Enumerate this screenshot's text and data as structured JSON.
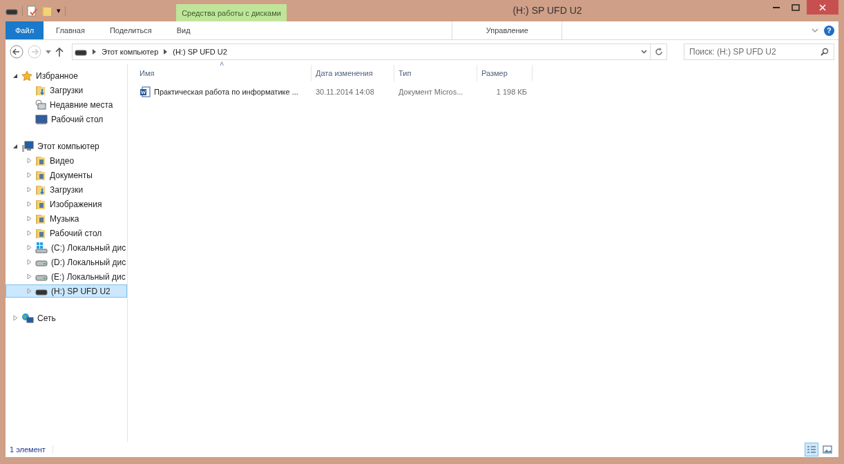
{
  "window": {
    "title": "(H:) SP UFD U2"
  },
  "quick_access": {
    "menu_glyph": "▾"
  },
  "contextual_group": {
    "label": "Средства работы с дисками"
  },
  "ribbon_tabs": [
    {
      "label": "Файл",
      "kind": "file",
      "selected": false
    },
    {
      "label": "Главная",
      "kind": "tab",
      "selected": false
    },
    {
      "label": "Поделиться",
      "kind": "tab",
      "selected": false
    },
    {
      "label": "Вид",
      "kind": "tab",
      "selected": false
    },
    {
      "label": "Управление",
      "kind": "contextual",
      "selected": false
    }
  ],
  "help": {
    "label": "?"
  },
  "address_bar": {
    "crumbs": [
      "Этот компьютер",
      "(H:) SP UFD U2"
    ]
  },
  "search": {
    "placeholder": "Поиск: (H:) SP UFD U2"
  },
  "navigation": [
    {
      "label": "Избранное",
      "kind": "favorites",
      "expanded": true,
      "selected": false,
      "children": [
        {
          "label": "Загрузки",
          "kind": "downloads",
          "selected": false
        },
        {
          "label": "Недавние места",
          "kind": "recent",
          "selected": false
        },
        {
          "label": "Рабочий стол",
          "kind": "desktop",
          "selected": false
        }
      ]
    },
    {
      "label": "Этот компьютер",
      "kind": "computer",
      "expanded": true,
      "selected": false,
      "children": [
        {
          "label": "Видео",
          "kind": "folder",
          "expanded": false,
          "selected": false
        },
        {
          "label": "Документы",
          "kind": "folder",
          "expanded": false,
          "selected": false
        },
        {
          "label": "Загрузки",
          "kind": "downloads",
          "expanded": false,
          "selected": false
        },
        {
          "label": "Изображения",
          "kind": "folder",
          "expanded": false,
          "selected": false
        },
        {
          "label": "Музыка",
          "kind": "folder",
          "expanded": false,
          "selected": false
        },
        {
          "label": "Рабочий стол",
          "kind": "folder",
          "expanded": false,
          "selected": false
        },
        {
          "label": "(C:) Локальный дис",
          "kind": "system-drive",
          "expanded": false,
          "selected": false
        },
        {
          "label": "(D:) Локальный дис",
          "kind": "drive",
          "expanded": false,
          "selected": false
        },
        {
          "label": "(E:) Локальный дис",
          "kind": "drive",
          "expanded": false,
          "selected": false
        },
        {
          "label": "(H:) SP UFD U2",
          "kind": "usb-drive",
          "expanded": false,
          "selected": true
        }
      ]
    },
    {
      "label": "Сеть",
      "kind": "network",
      "expanded": false,
      "selected": false
    }
  ],
  "table": {
    "sort_glyph": "˄",
    "columns": [
      "Имя",
      "Дата изменения",
      "Тип",
      "Размер"
    ],
    "rows": [
      {
        "name": "Практическая работа по информатике ...",
        "date": "30.11.2014 14:08",
        "type": "Документ Micros...",
        "size": "1 198 КБ",
        "selected": false
      }
    ]
  },
  "status_bar": {
    "text": "1 элемент",
    "view_buttons": [
      {
        "kind": "details",
        "selected": true
      },
      {
        "kind": "large-icons",
        "selected": false
      }
    ]
  }
}
